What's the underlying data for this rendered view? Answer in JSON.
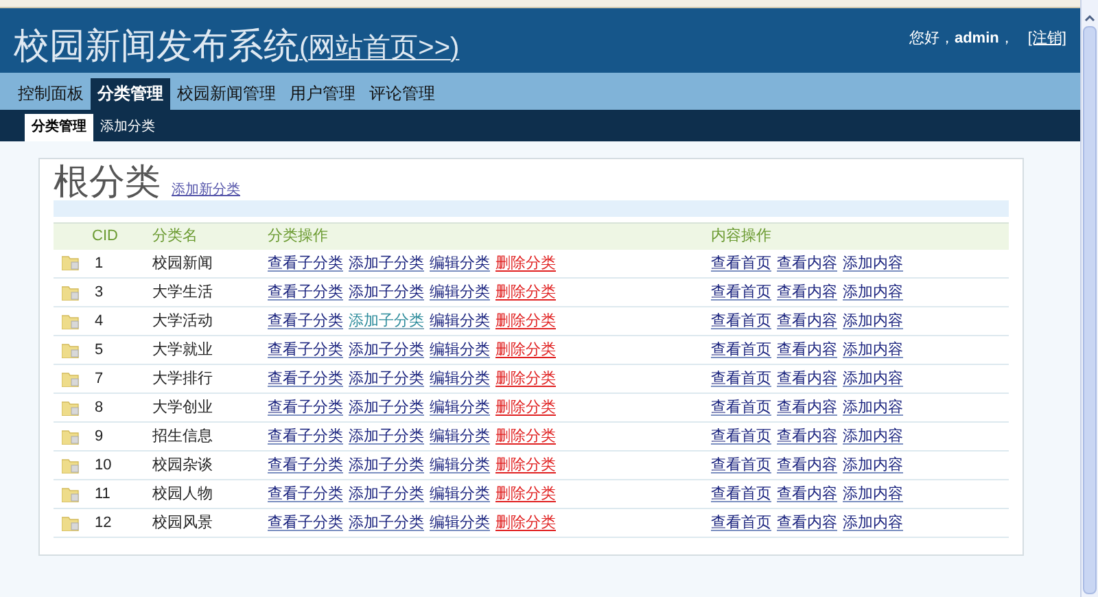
{
  "header": {
    "title": "校园新闻发布系统",
    "home_link": "(网站首页>>)",
    "greeting": "您好，",
    "user": "admin",
    "user_suffix": "，",
    "logout": "[注销]"
  },
  "nav": [
    {
      "label": "控制面板",
      "selected": false
    },
    {
      "label": "分类管理",
      "selected": true
    },
    {
      "label": "校园新闻管理",
      "selected": false
    },
    {
      "label": "用户管理",
      "selected": false
    },
    {
      "label": "评论管理",
      "selected": false
    }
  ],
  "subnav": [
    {
      "label": "分类管理",
      "selected": true
    },
    {
      "label": "添加分类",
      "selected": false
    }
  ],
  "panel": {
    "title": "根分类",
    "add_link": "添加新分类"
  },
  "table": {
    "columns": [
      "CID",
      "分类名",
      "分类操作",
      "内容操作"
    ],
    "rows": [
      {
        "cid": "1",
        "name": "校园新闻",
        "ops": [
          "查看子分类",
          "添加子分类",
          "编辑分类",
          "删除分类"
        ],
        "content_ops": [
          "查看首页",
          "查看内容",
          "添加内容"
        ],
        "add_child_hovered": false
      },
      {
        "cid": "3",
        "name": "大学生活",
        "ops": [
          "查看子分类",
          "添加子分类",
          "编辑分类",
          "删除分类"
        ],
        "content_ops": [
          "查看首页",
          "查看内容",
          "添加内容"
        ],
        "add_child_hovered": false
      },
      {
        "cid": "4",
        "name": "大学活动",
        "ops": [
          "查看子分类",
          "添加子分类",
          "编辑分类",
          "删除分类"
        ],
        "content_ops": [
          "查看首页",
          "查看内容",
          "添加内容"
        ],
        "add_child_hovered": true
      },
      {
        "cid": "5",
        "name": "大学就业",
        "ops": [
          "查看子分类",
          "添加子分类",
          "编辑分类",
          "删除分类"
        ],
        "content_ops": [
          "查看首页",
          "查看内容",
          "添加内容"
        ],
        "add_child_hovered": false
      },
      {
        "cid": "7",
        "name": "大学排行",
        "ops": [
          "查看子分类",
          "添加子分类",
          "编辑分类",
          "删除分类"
        ],
        "content_ops": [
          "查看首页",
          "查看内容",
          "添加内容"
        ],
        "add_child_hovered": false
      },
      {
        "cid": "8",
        "name": "大学创业",
        "ops": [
          "查看子分类",
          "添加子分类",
          "编辑分类",
          "删除分类"
        ],
        "content_ops": [
          "查看首页",
          "查看内容",
          "添加内容"
        ],
        "add_child_hovered": false
      },
      {
        "cid": "9",
        "name": "招生信息",
        "ops": [
          "查看子分类",
          "添加子分类",
          "编辑分类",
          "删除分类"
        ],
        "content_ops": [
          "查看首页",
          "查看内容",
          "添加内容"
        ],
        "add_child_hovered": false
      },
      {
        "cid": "10",
        "name": "校园杂谈",
        "ops": [
          "查看子分类",
          "添加子分类",
          "编辑分类",
          "删除分类"
        ],
        "content_ops": [
          "查看首页",
          "查看内容",
          "添加内容"
        ],
        "add_child_hovered": false
      },
      {
        "cid": "11",
        "name": "校园人物",
        "ops": [
          "查看子分类",
          "添加子分类",
          "编辑分类",
          "删除分类"
        ],
        "content_ops": [
          "查看首页",
          "查看内容",
          "添加内容"
        ],
        "add_child_hovered": false
      },
      {
        "cid": "12",
        "name": "校园风景",
        "ops": [
          "查看子分类",
          "添加子分类",
          "编辑分类",
          "删除分类"
        ],
        "content_ops": [
          "查看首页",
          "查看内容",
          "添加内容"
        ],
        "add_child_hovered": false
      }
    ]
  }
}
